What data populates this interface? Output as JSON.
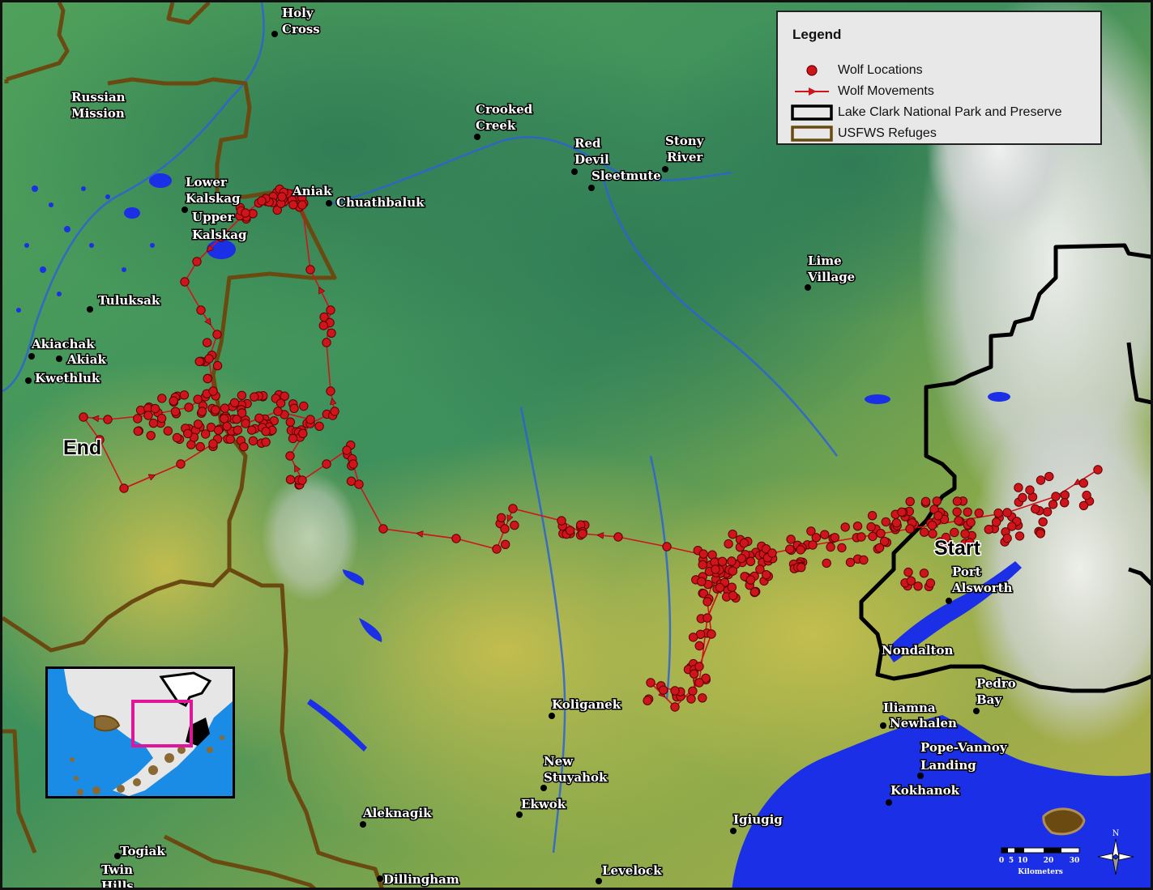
{
  "legend": {
    "title": "Legend",
    "items": [
      {
        "label": "Wolf Locations",
        "icon": "red-dot-icon"
      },
      {
        "label": "Wolf Movements",
        "icon": "red-arrow-line-icon"
      },
      {
        "label": "Lake Clark National Park and Preserve",
        "icon": "black-outline-box-icon"
      },
      {
        "label": "USFWS Refuges",
        "icon": "brown-outline-box-icon"
      }
    ]
  },
  "colors": {
    "wolf": "#d0141c",
    "park_boundary": "#000000",
    "refuge_boundary": "#6b4a12",
    "water": "#1a2fe6",
    "inset_highlight": "#e0159a"
  },
  "markers": {
    "start_label": "Start",
    "end_label": "End"
  },
  "towns": [
    {
      "name": "Holy",
      "name2": "Cross"
    },
    {
      "name": "Russian",
      "name2": "Mission"
    },
    {
      "name": "Crooked",
      "name2": "Creek"
    },
    {
      "name": "Red",
      "name2": "Devil"
    },
    {
      "name": "Sleetmute",
      "name2": ""
    },
    {
      "name": "Stony",
      "name2": "River"
    },
    {
      "name": "Lower",
      "name2": "Kalskag"
    },
    {
      "name": "Upper",
      "name2": "Kalskag"
    },
    {
      "name": "Aniak",
      "name2": ""
    },
    {
      "name": "Chuathbaluk",
      "name2": ""
    },
    {
      "name": "Lime",
      "name2": "Village"
    },
    {
      "name": "Tuluksak",
      "name2": ""
    },
    {
      "name": "Akiachak",
      "name2": ""
    },
    {
      "name": "Akiak",
      "name2": ""
    },
    {
      "name": "Kwethluk",
      "name2": ""
    },
    {
      "name": "Port",
      "name2": "Alsworth"
    },
    {
      "name": "Nondalton",
      "name2": ""
    },
    {
      "name": "Pedro",
      "name2": "Bay"
    },
    {
      "name": "Iliamna",
      "name2": ""
    },
    {
      "name": "Newhalen",
      "name2": ""
    },
    {
      "name": "Pope-Vannoy",
      "name2": "Landing"
    },
    {
      "name": "Kokhanok",
      "name2": ""
    },
    {
      "name": "Koliganek",
      "name2": ""
    },
    {
      "name": "New",
      "name2": "Stuyahok"
    },
    {
      "name": "Ekwok",
      "name2": ""
    },
    {
      "name": "Aleknagik",
      "name2": ""
    },
    {
      "name": "Igiugig",
      "name2": ""
    },
    {
      "name": "Togiak",
      "name2": ""
    },
    {
      "name": "Twin",
      "name2": "Hills"
    },
    {
      "name": "Dillingham",
      "name2": ""
    },
    {
      "name": "Levelock",
      "name2": ""
    }
  ],
  "scale": {
    "ticks": [
      "0",
      "5",
      "10",
      "20",
      "30"
    ],
    "unit": "Kilometers"
  },
  "north_arrow": {
    "label": "N"
  }
}
